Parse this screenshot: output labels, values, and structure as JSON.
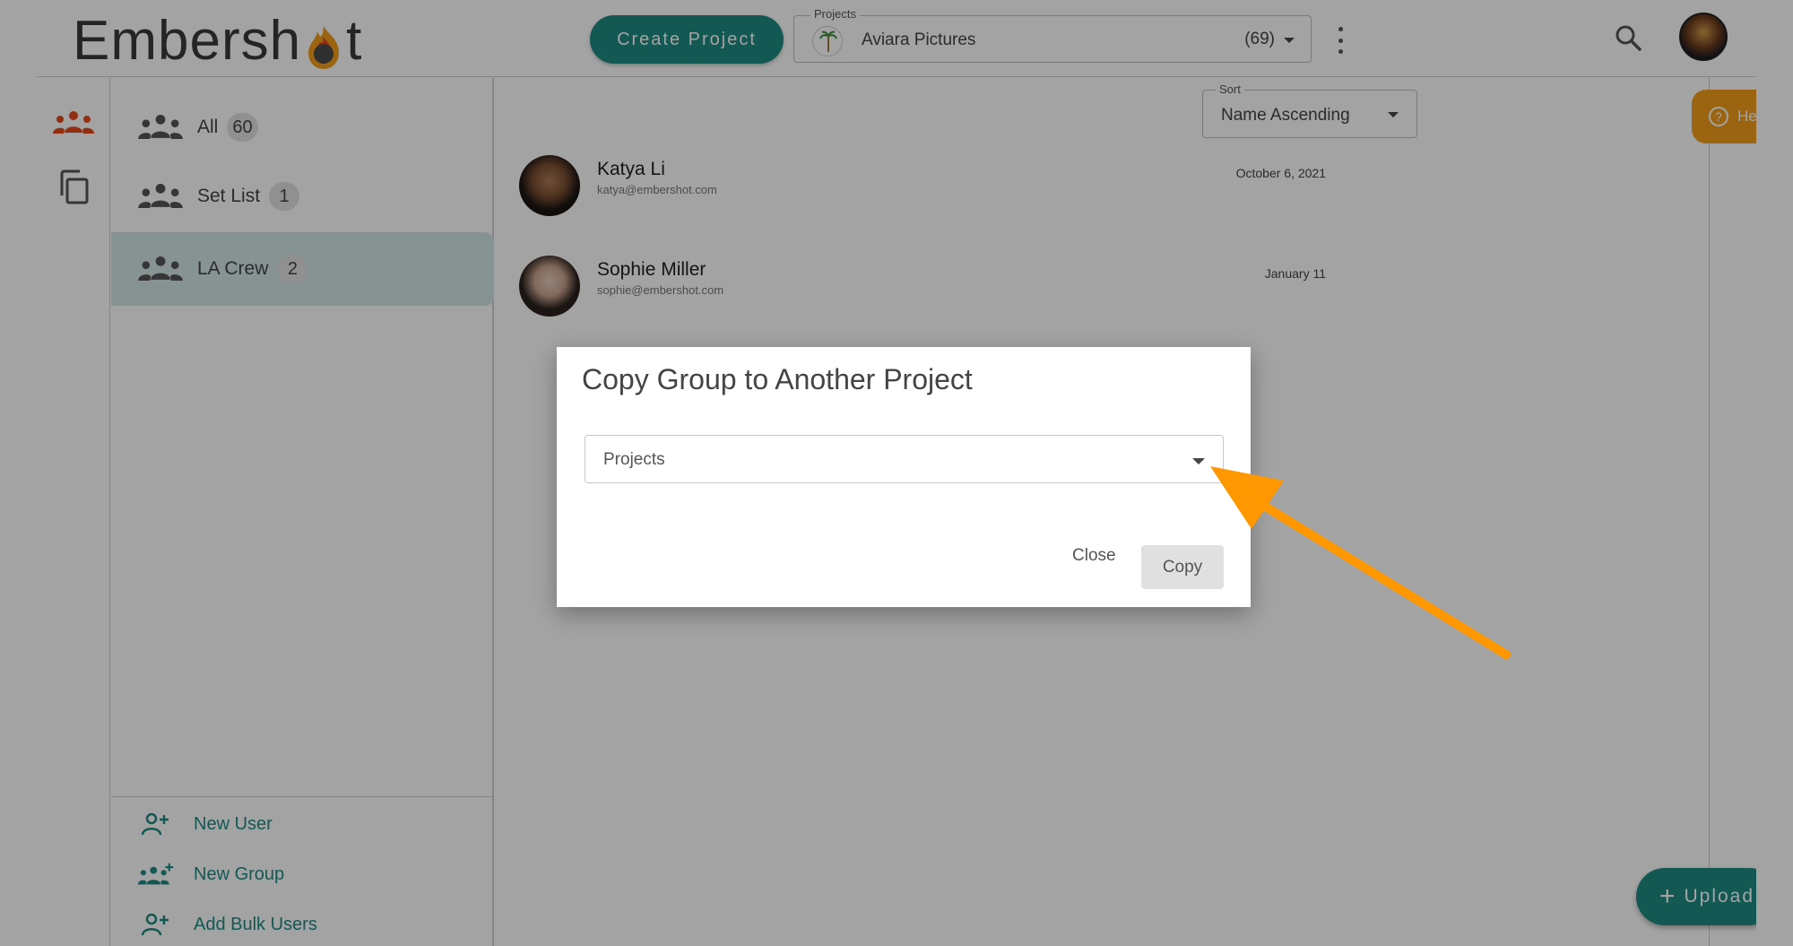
{
  "header": {
    "logo_text_left": "Embersh",
    "logo_text_right": "t",
    "create_project_label": "Create Project",
    "projects_legend": "Projects",
    "selected_project": "Aviara Pictures",
    "project_count": "(69)"
  },
  "groups": {
    "items": [
      {
        "name": "All",
        "count": "60"
      },
      {
        "name": "Set List",
        "count": "1"
      },
      {
        "name": "LA Crew",
        "count": "2"
      }
    ],
    "actions": [
      {
        "label": "New User"
      },
      {
        "label": "New Group"
      },
      {
        "label": "Add Bulk Users"
      }
    ]
  },
  "main": {
    "sort_legend": "Sort",
    "sort_value": "Name Ascending",
    "users": [
      {
        "name": "Katya Li",
        "email": "katya@embershot.com",
        "date": "October 6, 2021"
      },
      {
        "name": "Sophie Miller",
        "email": "sophie@embershot.com",
        "date": "January 11"
      }
    ],
    "help_label": "Help",
    "upload_label": "Upload"
  },
  "dialog": {
    "title": "Copy Group to Another Project",
    "select_placeholder": "Projects",
    "close_label": "Close",
    "copy_label": "Copy"
  },
  "colors": {
    "teal": "#1f8a82",
    "orange": "#f29d1b",
    "selected_group_bg": "#d3e7e6",
    "annotation_arrow": "#ff9800"
  },
  "icons": {
    "rail": [
      "users-group-icon",
      "copy-icon"
    ],
    "header": [
      "search-icon",
      "kebab-menu-icon"
    ]
  }
}
